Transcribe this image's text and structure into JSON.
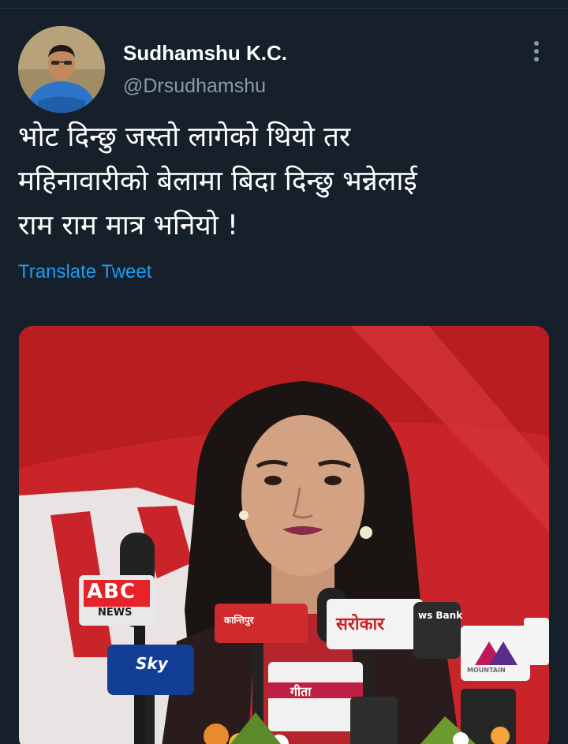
{
  "tweet": {
    "author": {
      "display_name": "Sudhamshu K.C.",
      "handle": "@Drsudhamshu"
    },
    "text_lines": [
      "भोट दिन्छु जस्तो लागेको थियो तर",
      "महिनावारीको बेलामा बिदा दिन्छु भन्नेलाई",
      "राम राम मात्र भनियो !"
    ],
    "translate_label": "Translate Tweet",
    "icons": {
      "more": "more-vertical-icon"
    }
  },
  "media": {
    "mic_logos": {
      "abc": "ABC",
      "abc_sub": "NEWS",
      "sarokar": "सरोकार",
      "sky": "Sky",
      "gorkha": "गीता",
      "mountain": "MOUNTAIN",
      "news_bank": "ws Bank",
      "kantipur": "कान्तिपुर"
    }
  },
  "colors": {
    "background": "#15202b",
    "text_primary": "#ffffff",
    "text_secondary": "#8b98a5",
    "link": "#1d9bf0"
  }
}
